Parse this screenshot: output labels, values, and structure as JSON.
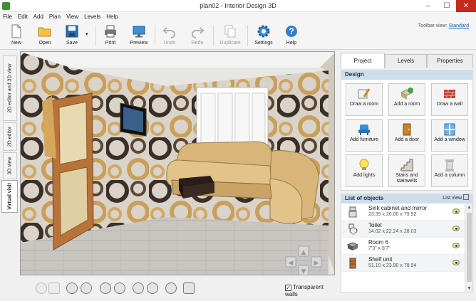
{
  "window": {
    "title": "plan02 - Interior Design 3D",
    "minimize": "–",
    "maximize": "☐",
    "close": "✕"
  },
  "menu": [
    "File",
    "Edit",
    "Add",
    "Plan",
    "View",
    "Levels",
    "Help"
  ],
  "toolbar": {
    "buttons": [
      {
        "label": "New",
        "icon": "new-file-icon"
      },
      {
        "label": "Open",
        "icon": "folder-icon"
      },
      {
        "label": "Save",
        "icon": "floppy-icon"
      },
      {
        "label": "Print",
        "icon": "printer-icon"
      },
      {
        "label": "Preview",
        "icon": "monitor-icon"
      },
      {
        "label": "Undo",
        "icon": "undo-icon"
      },
      {
        "label": "Redo",
        "icon": "redo-icon"
      },
      {
        "label": "Duplicate",
        "icon": "duplicate-icon"
      },
      {
        "label": "Settings",
        "icon": "gear-icon"
      },
      {
        "label": "Help",
        "icon": "help-icon"
      }
    ],
    "view_label": "Toolbar view:",
    "view_value": "Standard"
  },
  "left_tabs": [
    "2D editor and 3D view",
    "2D editor",
    "3D view",
    "Virtual visit"
  ],
  "active_left_tab": "Virtual visit",
  "bottom": {
    "transparent_walls_label": "Transparent walls",
    "transparent_walls_checked": true,
    "checkmark": "✓"
  },
  "panel": {
    "tabs": [
      "Project",
      "Levels",
      "Properties"
    ],
    "active_tab": "Project",
    "design_header": "Design",
    "design_buttons": [
      {
        "label": "Draw a room",
        "icon": "draw-room-icon"
      },
      {
        "label": "Add a room",
        "icon": "add-room-icon"
      },
      {
        "label": "Draw a wall",
        "icon": "brick-wall-icon"
      },
      {
        "label": "Add furniture",
        "icon": "armchair-icon"
      },
      {
        "label": "Add a door",
        "icon": "door-icon"
      },
      {
        "label": "Add a window",
        "icon": "window-icon"
      },
      {
        "label": "Add lights",
        "icon": "bulb-icon"
      },
      {
        "label": "Stairs and stairwells",
        "icon": "stairs-icon"
      },
      {
        "label": "Add a column",
        "icon": "column-icon"
      }
    ],
    "objects_header": "List of objects",
    "list_view_label": "List view",
    "objects": [
      {
        "name": "Sink cabinet and mirror",
        "dims": "23.39 x 20.00 x 79.92"
      },
      {
        "name": "Toilet",
        "dims": "14.02 x 22.24 x 28.03"
      },
      {
        "name": "Room 6",
        "dims": "7'3\" x 8'7\""
      },
      {
        "name": "Shelf unit",
        "dims": "51.10 x 23.90 x 78.94"
      }
    ]
  },
  "colors": {
    "accent": "#1a5fb4",
    "panel_header": "#cfdcea",
    "close": "#c42b1c"
  }
}
